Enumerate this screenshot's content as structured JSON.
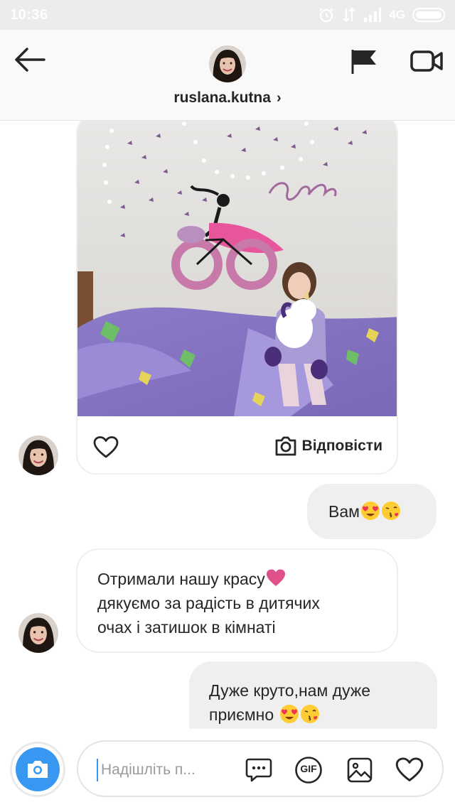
{
  "status_bar": {
    "time": "10:36",
    "network": "4G"
  },
  "header": {
    "username": "ruslana.kutna",
    "chevron": "›"
  },
  "icons": {
    "back": "back-arrow-icon",
    "flag": "flag-icon",
    "video": "video-call-icon",
    "like": "heart-outline-icon",
    "reply_camera": "camera-outline-icon",
    "composer_camera": "camera-icon",
    "sticker": "chat-bubble-dots-icon",
    "gif": "gif-icon",
    "gallery": "gallery-icon",
    "heart": "heart-icon"
  },
  "post": {
    "reply_label": "Відповісти"
  },
  "messages": [
    {
      "direction": "outgoing",
      "text": "Вам",
      "emojis": [
        "heart-eyes",
        "kiss"
      ]
    },
    {
      "direction": "incoming",
      "lines": [
        "Отримали нашу красу",
        "дякуємо за радість в дитячих",
        "очах і затишок в кімнаті"
      ],
      "emojis": [
        "heart"
      ]
    },
    {
      "direction": "outgoing",
      "lines": [
        "Дуже круто,нам дуже",
        "приємно"
      ],
      "emojis": [
        "heart-eyes",
        "kiss"
      ]
    }
  ],
  "composer": {
    "placeholder": "Надішліть п...",
    "gif_label": "GIF"
  },
  "colors": {
    "accent": "#3897f0",
    "bubble_out": "#efefef",
    "text": "#262626",
    "status_bar": "#ececec"
  }
}
